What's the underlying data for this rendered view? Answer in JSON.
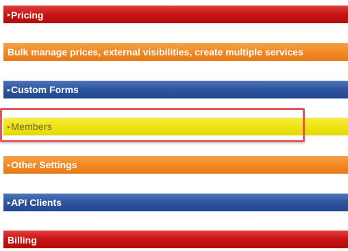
{
  "sections": {
    "pricing": {
      "arrow": "▸",
      "label": "Pricing"
    },
    "bulk_manage": {
      "label": "Bulk manage prices, external visibilities, create multiple services"
    },
    "custom_forms": {
      "arrow": "▸",
      "label": "Custom Forms"
    },
    "members": {
      "arrow": "▸",
      "label": "Members"
    },
    "other_settings": {
      "arrow": "▸",
      "label": "Other Settings"
    },
    "api_clients": {
      "arrow": "▸",
      "label": "API Clients"
    },
    "billing": {
      "label": "Billing"
    }
  },
  "colors": {
    "red": "#c91515",
    "orange": "#f08a26",
    "blue": "#2f55a0",
    "yellow": "#efe414",
    "highlight_border": "#e2575c"
  },
  "icons": {
    "collapsed_arrow": "triangle-right-icon"
  }
}
